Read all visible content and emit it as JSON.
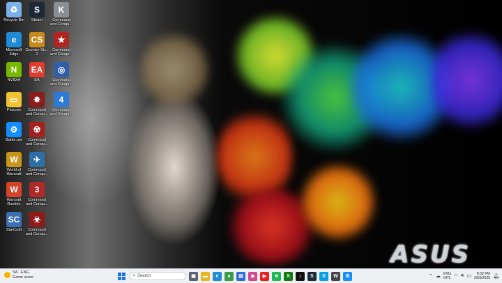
{
  "desktop_icons": [
    {
      "label": "Recycle Bin",
      "icon": "recycle-bin-icon",
      "color": "#7ab0e6",
      "glyph": "♻"
    },
    {
      "label": "Steam",
      "icon": "steam-icon",
      "color": "#1b2838",
      "glyph": "S"
    },
    {
      "label": "Command and Conqu...",
      "icon": "command-and-conquer-icon",
      "color": "#8a8f96",
      "glyph": "K"
    },
    {
      "label": "Microsoft Edge",
      "icon": "edge-icon",
      "color": "#1f8ad6",
      "glyph": "e"
    },
    {
      "label": "Counter-Str... 2",
      "icon": "counter-strike-icon",
      "color": "#c98a1c",
      "glyph": "CS"
    },
    {
      "label": "Command and Conqu...",
      "icon": "command-and-conquer-icon",
      "color": "#b12424",
      "glyph": "★"
    },
    {
      "label": "NVIDIA",
      "icon": "nvidia-icon",
      "color": "#76b900",
      "glyph": "N"
    },
    {
      "label": "EA",
      "icon": "ea-icon",
      "color": "#e03b2d",
      "glyph": "EA"
    },
    {
      "label": "Command and Conqu...",
      "icon": "command-and-conquer-icon",
      "color": "#2f5fa8",
      "glyph": "◎"
    },
    {
      "label": "Pictures",
      "icon": "pictures-folder-icon",
      "color": "#f1c232",
      "glyph": "▭"
    },
    {
      "label": "Command and Conqu...",
      "icon": "command-and-conquer-icon",
      "color": "#8c1c1c",
      "glyph": "✸"
    },
    {
      "label": "Command and Conqu...",
      "icon": "command-and-conquer-icon",
      "color": "#2b7bd6",
      "glyph": "4"
    },
    {
      "label": "Battle.net",
      "icon": "battlenet-icon",
      "color": "#148eff",
      "glyph": "⚙"
    },
    {
      "label": "Command and Conqu...",
      "icon": "command-and-conquer-icon",
      "color": "#a32020",
      "glyph": "☢"
    },
    {
      "label": "World of Warcraft",
      "icon": "world-of-warcraft-icon",
      "color": "#c8951b",
      "glyph": "W"
    },
    {
      "label": "Command and Conqu...",
      "icon": "command-and-conquer-icon",
      "color": "#2d6ea6",
      "glyph": "✈"
    },
    {
      "label": "Warcraft Rumble",
      "icon": "warcraft-rumble-icon",
      "color": "#d3442a",
      "glyph": "W"
    },
    {
      "label": "Command and Conqu...",
      "icon": "command-and-conquer-icon",
      "color": "#b02a2a",
      "glyph": "3"
    },
    {
      "label": "StarCraft",
      "icon": "starcraft-icon",
      "color": "#3c6fb3",
      "glyph": "SC"
    },
    {
      "label": "Command and Conqu...",
      "icon": "command-and-conquer-icon",
      "color": "#8e1a1a",
      "glyph": "☣"
    }
  ],
  "wallpaper": {
    "brand_text": "ASUS"
  },
  "taskbar": {
    "weather_line1": "SA - ENG",
    "weather_line2": "Game score",
    "search_placeholder": "Search",
    "apps": [
      {
        "name": "task-view-icon",
        "color": "#5a6270",
        "glyph": "▣"
      },
      {
        "name": "file-explorer-icon",
        "color": "#e8b520",
        "glyph": "▬"
      },
      {
        "name": "edge-taskbar-icon",
        "color": "#1f8ad6",
        "glyph": "e"
      },
      {
        "name": "chrome-icon",
        "color": "#3a9c4a",
        "glyph": "●"
      },
      {
        "name": "store-icon",
        "color": "#2f6bd8",
        "glyph": "▤"
      },
      {
        "name": "photos-icon",
        "color": "#d24a8b",
        "glyph": "◆"
      },
      {
        "name": "youtube-icon",
        "color": "#e52020",
        "glyph": "▶"
      },
      {
        "name": "spotify-icon",
        "color": "#1db954",
        "glyph": "≋"
      },
      {
        "name": "xbox-icon",
        "color": "#107c10",
        "glyph": "X"
      },
      {
        "name": "tiktok-icon",
        "color": "#111111",
        "glyph": "♪"
      },
      {
        "name": "steam-taskbar-icon",
        "color": "#1b2838",
        "glyph": "S"
      },
      {
        "name": "skype-icon",
        "color": "#0a9ee6",
        "glyph": "S"
      },
      {
        "name": "wikipedia-icon",
        "color": "#444444",
        "glyph": "W"
      },
      {
        "name": "battlenet-taskbar-icon",
        "color": "#148eff",
        "glyph": "⚙"
      }
    ],
    "lang_line1": "ENG",
    "lang_line2": "INTL",
    "time": "8:32 PM",
    "date": "2/03/2025"
  }
}
